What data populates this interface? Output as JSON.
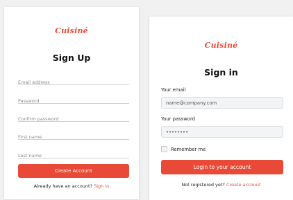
{
  "signup": {
    "logo": "Cuisiné",
    "title": "Sign Up",
    "email_placeholder": "Email address",
    "password_placeholder": "Password",
    "confirm_placeholder": "Confirm password",
    "first_name_placeholder": "First name",
    "last_name_placeholder": "Last name",
    "submit_label": "Create Account",
    "footer_prefix": "Already have an account?",
    "footer_link": "Sign in"
  },
  "signin": {
    "logo": "Cuisiné",
    "title": "Sign in",
    "email_label": "Your email",
    "email_value": "name@company.com",
    "password_label": "Your password",
    "password_value": "••••••••",
    "remember_label": "Remember me",
    "remember_checked": false,
    "submit_label": "Login to your account",
    "footer_prefix": "Not registered yet?",
    "footer_link": "Create account"
  },
  "colors": {
    "brand": "#e84a37",
    "background": "#f1f1f1",
    "card": "#ffffff",
    "field_bg": "#f3f4f6"
  }
}
